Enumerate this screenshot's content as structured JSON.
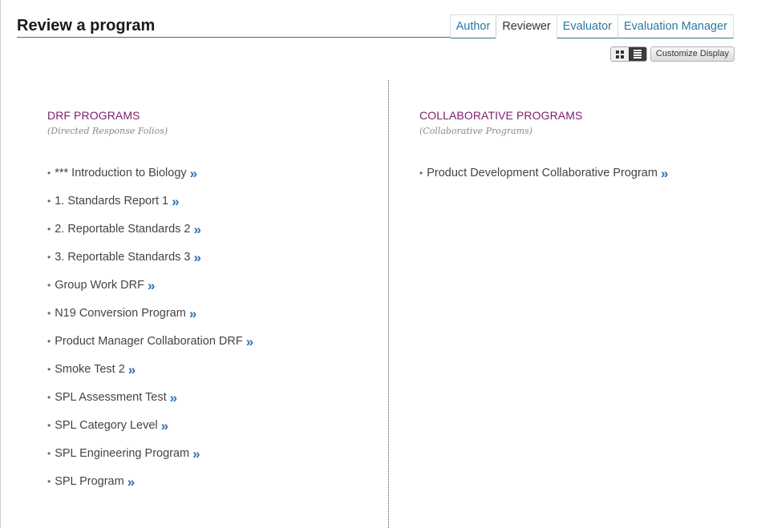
{
  "page": {
    "title": "Review a program"
  },
  "tabs": [
    {
      "label": "Author",
      "active": false
    },
    {
      "label": "Reviewer",
      "active": true
    },
    {
      "label": "Evaluator",
      "active": false
    },
    {
      "label": "Evaluation Manager",
      "active": false
    }
  ],
  "toolbar": {
    "customize_label": "Customize Display",
    "view_mode": "list"
  },
  "drf": {
    "title": "DRF PROGRAMS",
    "subtitle": "(Directed Response Folios)",
    "items": [
      "*** Introduction to Biology",
      "1. Standards Report 1",
      "2. Reportable Standards 2",
      "3. Reportable Standards 3",
      "Group Work DRF",
      "N19 Conversion Program",
      "Product Manager Collaboration DRF",
      "Smoke Test 2",
      "SPL Assessment Test",
      "SPL Category Level",
      "SPL Engineering Program",
      "SPL Program"
    ]
  },
  "collab": {
    "title": "COLLABORATIVE PROGRAMS",
    "subtitle": "(Collaborative Programs)",
    "items": [
      "Product Development Collaborative Program"
    ]
  },
  "symbols": {
    "bullet": "•",
    "more": "»"
  },
  "colors": {
    "section_title": "#7b1f6a",
    "tab_link": "#2a7a9e",
    "arrow": "#2f6fb2"
  }
}
